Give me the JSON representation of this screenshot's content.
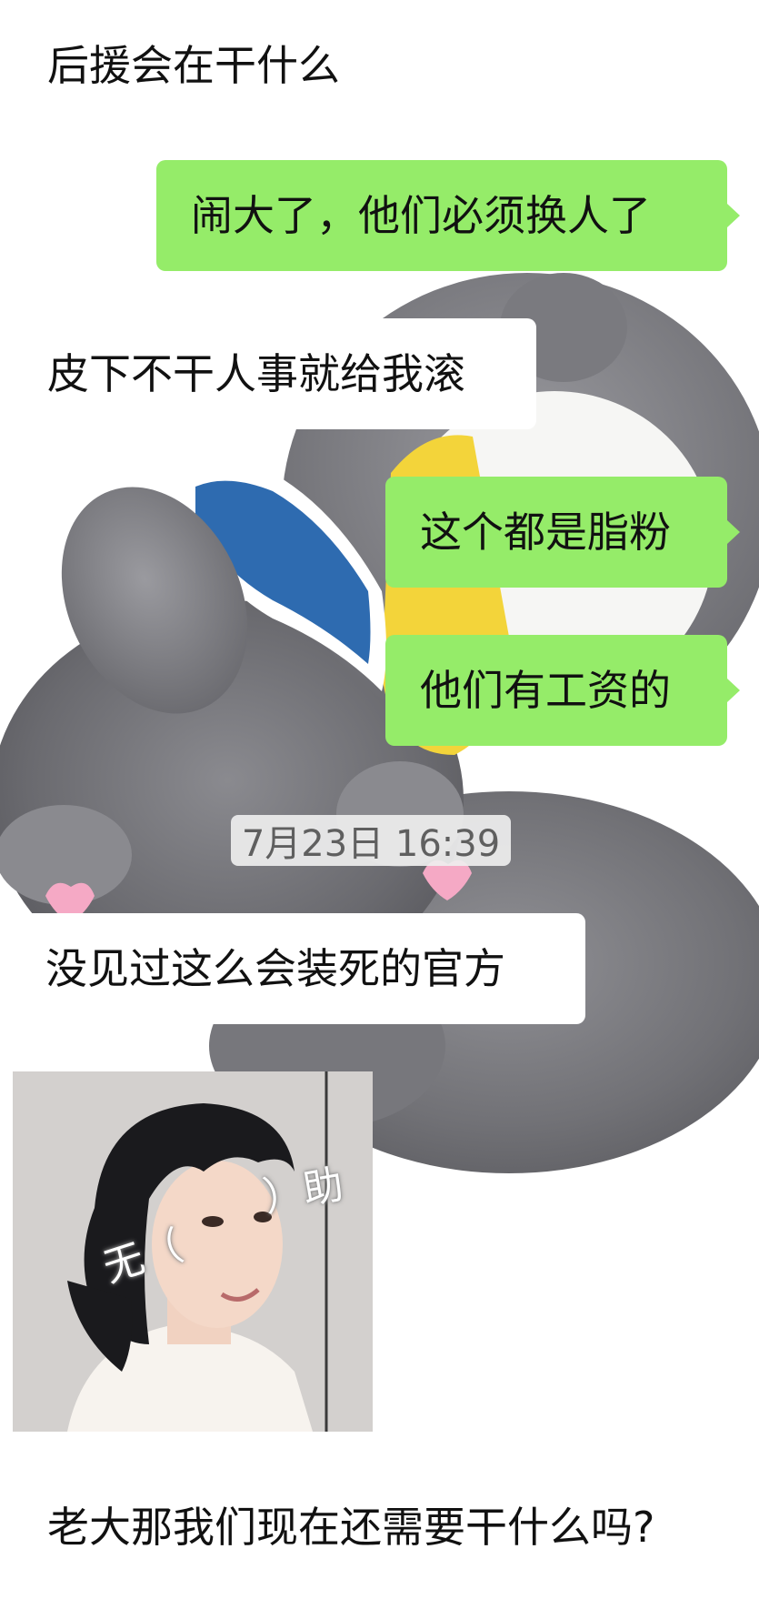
{
  "messages": {
    "m1": "后援会在干什么",
    "m2": "闹大了，他们必须换人了",
    "m3": "皮下不干人事就给我滚",
    "m4": "这个都是脂粉",
    "m5": "他们有工资的",
    "timestamp": "7月23日 16:39",
    "m6": "没见过这么会装死的官方",
    "m7": "老大那我们现在还需要干什么吗?"
  },
  "sticker": {
    "left_text": "无（",
    "right_text": "）助"
  },
  "colors": {
    "outgoing_bubble": "#95ec69",
    "incoming_bubble": "#ffffff",
    "plush_fur": "#6e6e72",
    "hat_blue": "#2e6bb0",
    "duck_yellow": "#f3d43a"
  }
}
